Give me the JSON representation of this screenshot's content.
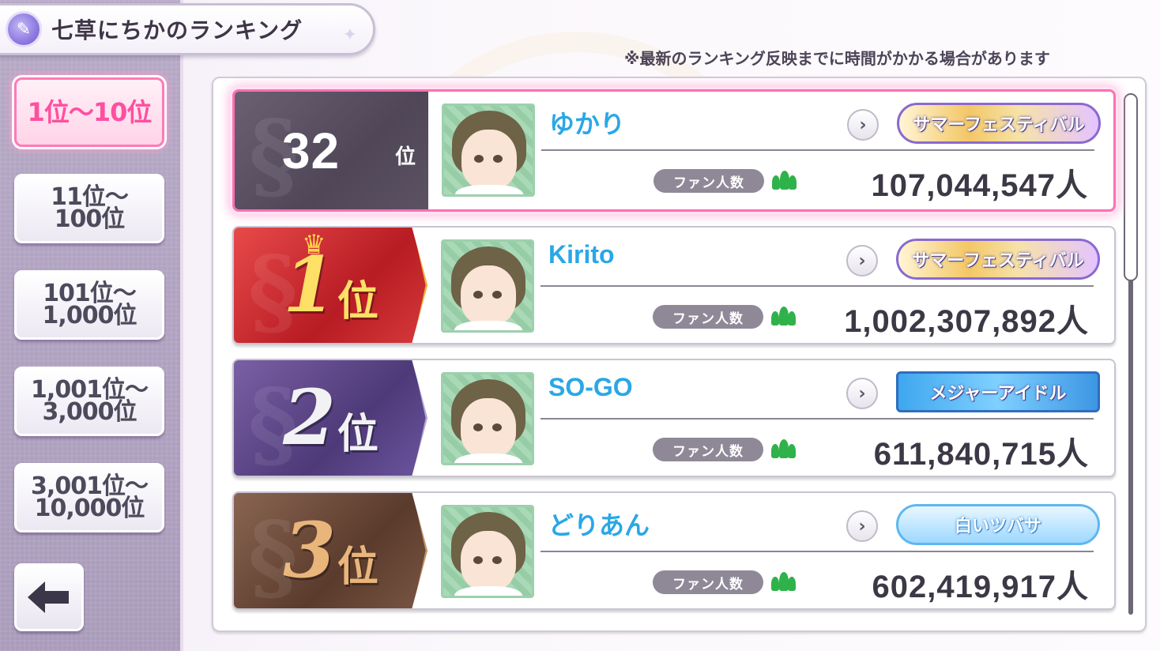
{
  "header": {
    "title": "七草にちかのランキング",
    "notice": "※最新のランキング反映までに時間がかかる場合があります"
  },
  "tabs": [
    {
      "label": "1位～10位",
      "active": true
    },
    {
      "label": "11位～\n100位",
      "active": false
    },
    {
      "label": "101位～\n1,000位",
      "active": false
    },
    {
      "label": "1,001位～\n3,000位",
      "active": false
    },
    {
      "label": "3,001位～\n10,000位",
      "active": false
    }
  ],
  "fan_label": "ファン人数",
  "rows": [
    {
      "rank": "32",
      "rank_unit": "位",
      "name": "ゆかり",
      "fans": "107,044,547人",
      "badge": "サマーフェスティバル",
      "style": "mine"
    },
    {
      "rank": "1",
      "rank_unit": "位",
      "name": "Kirito",
      "fans": "1,002,307,892人",
      "badge": "サマーフェスティバル",
      "style": "gold"
    },
    {
      "rank": "2",
      "rank_unit": "位",
      "name": "SO-GO",
      "fans": "611,840,715人",
      "badge": "メジャーアイドル",
      "style": "silver"
    },
    {
      "rank": "3",
      "rank_unit": "位",
      "name": "どりあん",
      "fans": "602,419,917人",
      "badge": "白いツバサ",
      "style": "bronze"
    }
  ],
  "colors": {
    "accent_pink": "#ff4fa0",
    "name_blue": "#2aa7e6",
    "fan_green": "#2fb24a"
  },
  "icons": {
    "title": "feather-icon",
    "back": "back-arrow-icon",
    "row_arrow": "chevron-right-icon",
    "fans": "people-icon"
  }
}
